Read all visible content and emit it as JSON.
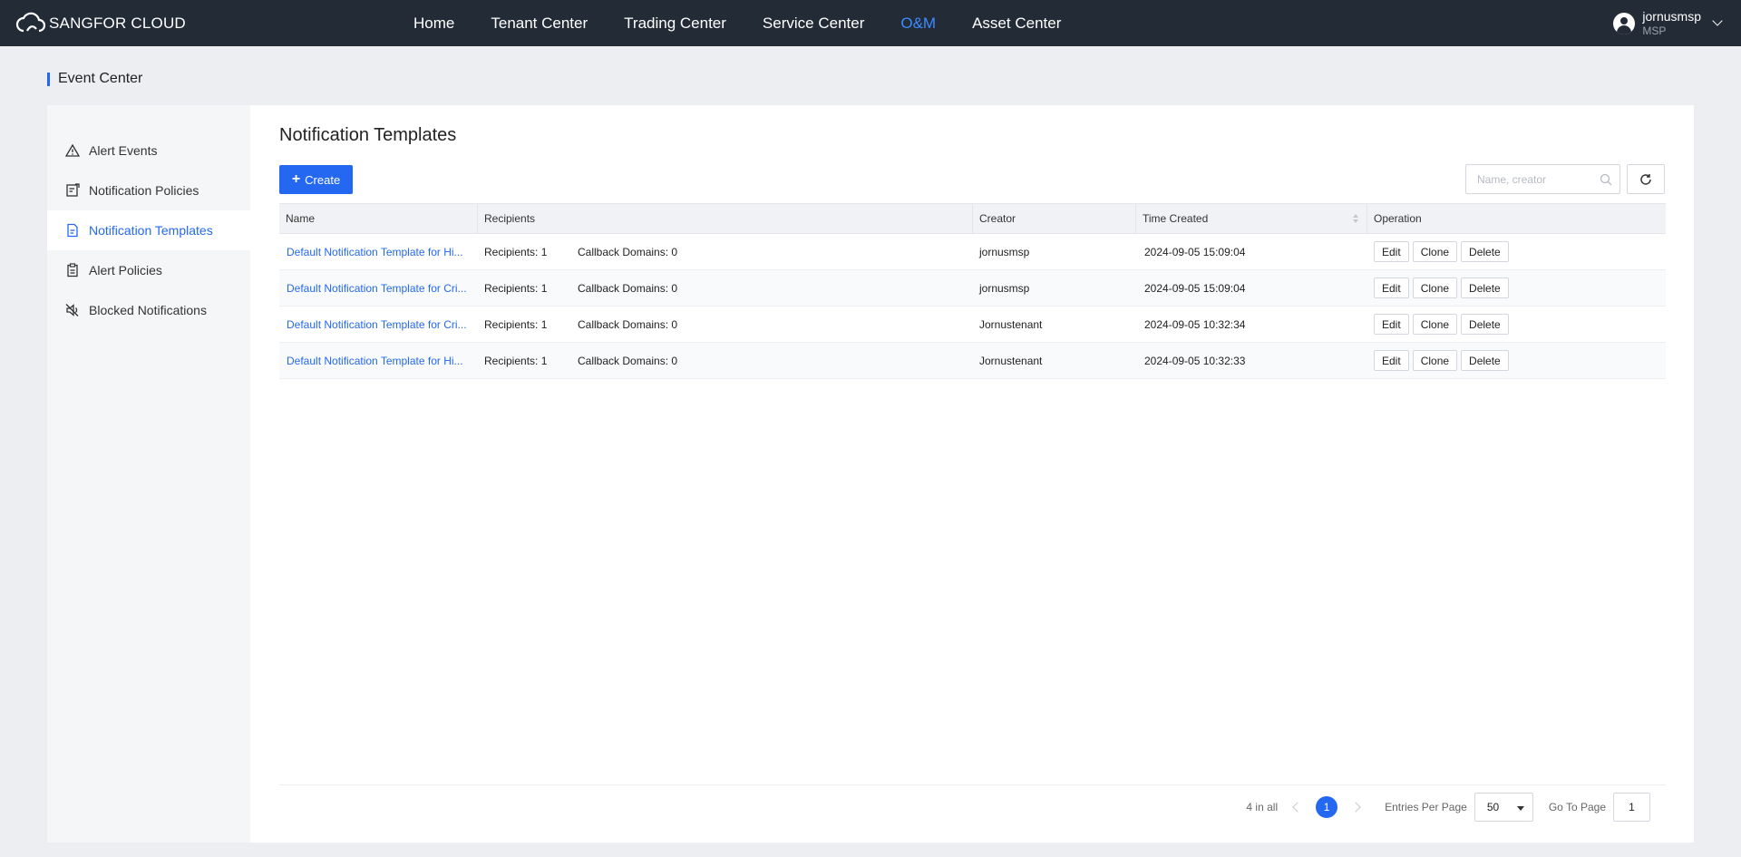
{
  "brand": {
    "name": "SANGFOR CLOUD"
  },
  "nav": {
    "items": [
      {
        "label": "Home"
      },
      {
        "label": "Tenant Center"
      },
      {
        "label": "Trading Center"
      },
      {
        "label": "Service Center"
      },
      {
        "label": "O&M",
        "active": true
      },
      {
        "label": "Asset Center"
      }
    ]
  },
  "user": {
    "name": "jornusmsp",
    "role": "MSP"
  },
  "page": {
    "title": "Event Center"
  },
  "sidebar": {
    "items": [
      {
        "label": "Alert Events",
        "icon": "warning-icon"
      },
      {
        "label": "Notification Policies",
        "icon": "policy-doc-icon"
      },
      {
        "label": "Notification Templates",
        "icon": "template-doc-icon",
        "active": true
      },
      {
        "label": "Alert Policies",
        "icon": "clipboard-icon"
      },
      {
        "label": "Blocked Notifications",
        "icon": "muted-speaker-icon"
      }
    ]
  },
  "main": {
    "title": "Notification Templates",
    "create_label": "Create",
    "search_placeholder": "Name, creator"
  },
  "table": {
    "columns": [
      "Name",
      "Recipients",
      "Creator",
      "Time Created",
      "Operation"
    ],
    "rows": [
      {
        "name": "Default Notification Template for Hi...",
        "recipients": "Recipients: 1",
        "callback": "Callback Domains: 0",
        "creator": "jornusmsp",
        "time": "2024-09-05 15:09:04"
      },
      {
        "name": "Default Notification Template for Cri...",
        "recipients": "Recipients: 1",
        "callback": "Callback Domains: 0",
        "creator": "jornusmsp",
        "time": "2024-09-05 15:09:04"
      },
      {
        "name": "Default Notification Template for Cri...",
        "recipients": "Recipients: 1",
        "callback": "Callback Domains: 0",
        "creator": "Jornustenant",
        "time": "2024-09-05 10:32:34"
      },
      {
        "name": "Default Notification Template for Hi...",
        "recipients": "Recipients: 1",
        "callback": "Callback Domains: 0",
        "creator": "Jornustenant",
        "time": "2024-09-05 10:32:33"
      }
    ],
    "ops": {
      "edit": "Edit",
      "clone": "Clone",
      "delete": "Delete"
    }
  },
  "pagination": {
    "total": "4 in all",
    "current_page": "1",
    "entries_label": "Entries Per Page",
    "entries_value": "50",
    "goto_label": "Go To Page",
    "goto_value": "1"
  },
  "colors": {
    "accent": "#2468f2",
    "topbar": "#232b36",
    "active_nav": "#3b8cff"
  }
}
